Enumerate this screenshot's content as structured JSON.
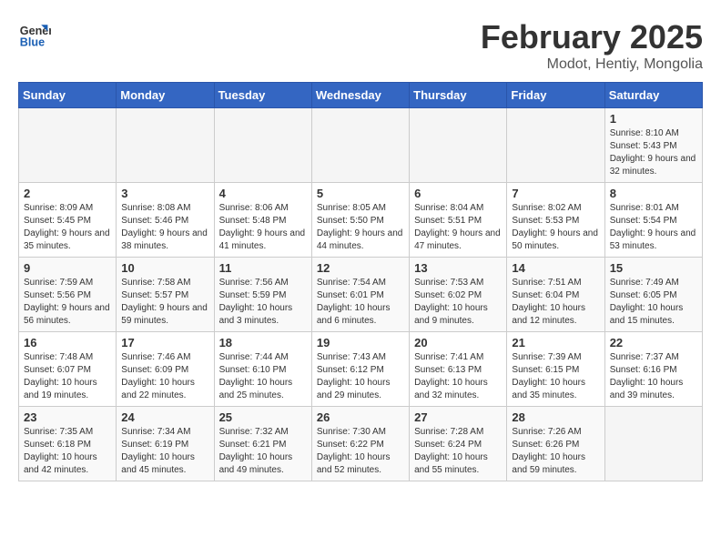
{
  "logo": {
    "line1": "General",
    "line2": "Blue"
  },
  "title": "February 2025",
  "subtitle": "Modot, Hentiy, Mongolia",
  "weekdays": [
    "Sunday",
    "Monday",
    "Tuesday",
    "Wednesday",
    "Thursday",
    "Friday",
    "Saturday"
  ],
  "weeks": [
    [
      {
        "day": "",
        "info": ""
      },
      {
        "day": "",
        "info": ""
      },
      {
        "day": "",
        "info": ""
      },
      {
        "day": "",
        "info": ""
      },
      {
        "day": "",
        "info": ""
      },
      {
        "day": "",
        "info": ""
      },
      {
        "day": "1",
        "info": "Sunrise: 8:10 AM\nSunset: 5:43 PM\nDaylight: 9 hours and 32 minutes."
      }
    ],
    [
      {
        "day": "2",
        "info": "Sunrise: 8:09 AM\nSunset: 5:45 PM\nDaylight: 9 hours and 35 minutes."
      },
      {
        "day": "3",
        "info": "Sunrise: 8:08 AM\nSunset: 5:46 PM\nDaylight: 9 hours and 38 minutes."
      },
      {
        "day": "4",
        "info": "Sunrise: 8:06 AM\nSunset: 5:48 PM\nDaylight: 9 hours and 41 minutes."
      },
      {
        "day": "5",
        "info": "Sunrise: 8:05 AM\nSunset: 5:50 PM\nDaylight: 9 hours and 44 minutes."
      },
      {
        "day": "6",
        "info": "Sunrise: 8:04 AM\nSunset: 5:51 PM\nDaylight: 9 hours and 47 minutes."
      },
      {
        "day": "7",
        "info": "Sunrise: 8:02 AM\nSunset: 5:53 PM\nDaylight: 9 hours and 50 minutes."
      },
      {
        "day": "8",
        "info": "Sunrise: 8:01 AM\nSunset: 5:54 PM\nDaylight: 9 hours and 53 minutes."
      }
    ],
    [
      {
        "day": "9",
        "info": "Sunrise: 7:59 AM\nSunset: 5:56 PM\nDaylight: 9 hours and 56 minutes."
      },
      {
        "day": "10",
        "info": "Sunrise: 7:58 AM\nSunset: 5:57 PM\nDaylight: 9 hours and 59 minutes."
      },
      {
        "day": "11",
        "info": "Sunrise: 7:56 AM\nSunset: 5:59 PM\nDaylight: 10 hours and 3 minutes."
      },
      {
        "day": "12",
        "info": "Sunrise: 7:54 AM\nSunset: 6:01 PM\nDaylight: 10 hours and 6 minutes."
      },
      {
        "day": "13",
        "info": "Sunrise: 7:53 AM\nSunset: 6:02 PM\nDaylight: 10 hours and 9 minutes."
      },
      {
        "day": "14",
        "info": "Sunrise: 7:51 AM\nSunset: 6:04 PM\nDaylight: 10 hours and 12 minutes."
      },
      {
        "day": "15",
        "info": "Sunrise: 7:49 AM\nSunset: 6:05 PM\nDaylight: 10 hours and 15 minutes."
      }
    ],
    [
      {
        "day": "16",
        "info": "Sunrise: 7:48 AM\nSunset: 6:07 PM\nDaylight: 10 hours and 19 minutes."
      },
      {
        "day": "17",
        "info": "Sunrise: 7:46 AM\nSunset: 6:09 PM\nDaylight: 10 hours and 22 minutes."
      },
      {
        "day": "18",
        "info": "Sunrise: 7:44 AM\nSunset: 6:10 PM\nDaylight: 10 hours and 25 minutes."
      },
      {
        "day": "19",
        "info": "Sunrise: 7:43 AM\nSunset: 6:12 PM\nDaylight: 10 hours and 29 minutes."
      },
      {
        "day": "20",
        "info": "Sunrise: 7:41 AM\nSunset: 6:13 PM\nDaylight: 10 hours and 32 minutes."
      },
      {
        "day": "21",
        "info": "Sunrise: 7:39 AM\nSunset: 6:15 PM\nDaylight: 10 hours and 35 minutes."
      },
      {
        "day": "22",
        "info": "Sunrise: 7:37 AM\nSunset: 6:16 PM\nDaylight: 10 hours and 39 minutes."
      }
    ],
    [
      {
        "day": "23",
        "info": "Sunrise: 7:35 AM\nSunset: 6:18 PM\nDaylight: 10 hours and 42 minutes."
      },
      {
        "day": "24",
        "info": "Sunrise: 7:34 AM\nSunset: 6:19 PM\nDaylight: 10 hours and 45 minutes."
      },
      {
        "day": "25",
        "info": "Sunrise: 7:32 AM\nSunset: 6:21 PM\nDaylight: 10 hours and 49 minutes."
      },
      {
        "day": "26",
        "info": "Sunrise: 7:30 AM\nSunset: 6:22 PM\nDaylight: 10 hours and 52 minutes."
      },
      {
        "day": "27",
        "info": "Sunrise: 7:28 AM\nSunset: 6:24 PM\nDaylight: 10 hours and 55 minutes."
      },
      {
        "day": "28",
        "info": "Sunrise: 7:26 AM\nSunset: 6:26 PM\nDaylight: 10 hours and 59 minutes."
      },
      {
        "day": "",
        "info": ""
      }
    ]
  ]
}
